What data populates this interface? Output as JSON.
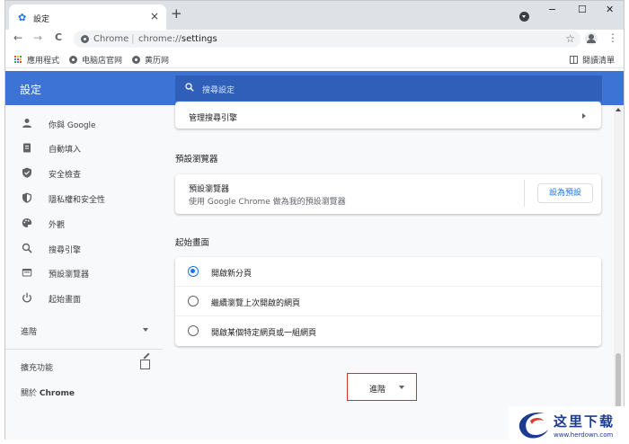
{
  "browser": {
    "tab_title": "設定",
    "tab_close": "×",
    "new_tab": "+",
    "window_controls": {
      "minimize": "−",
      "maximize": "☐",
      "close": "✕"
    },
    "nav": {
      "back": "←",
      "forward": "→",
      "reload": "C"
    },
    "chip": "Chrome",
    "url_sep": "|",
    "url_scheme": "chrome://",
    "url_path": "settings",
    "star": "☆",
    "menu": "⋮"
  },
  "bookmarks": {
    "items": [
      {
        "label": "應用程式",
        "icon": "apps-grid-icon"
      },
      {
        "label": "电脑店官网",
        "icon": "globe-icon"
      },
      {
        "label": "黄历网",
        "icon": "globe-icon"
      }
    ],
    "reading_list": "閱讀清單"
  },
  "header": {
    "title": "設定",
    "search_placeholder": "搜尋設定"
  },
  "sidebar": {
    "items": [
      {
        "label": "你與 Google",
        "icon": "person-icon"
      },
      {
        "label": "自動填入",
        "icon": "clipboard-icon"
      },
      {
        "label": "安全檢查",
        "icon": "shield-check-icon"
      },
      {
        "label": "隱私權和安全性",
        "icon": "shield-icon"
      },
      {
        "label": "外觀",
        "icon": "palette-icon"
      },
      {
        "label": "搜尋引擎",
        "icon": "search-icon"
      },
      {
        "label": "預設瀏覽器",
        "icon": "browser-icon"
      },
      {
        "label": "起始畫面",
        "icon": "power-icon"
      }
    ],
    "advanced": "進階",
    "extensions": "擴充功能",
    "about_prefix": "關於 ",
    "about_bold": "Chrome"
  },
  "main": {
    "manage_search_engines": "管理搜尋引擎",
    "default_browser_section": "預設瀏覽器",
    "default_browser_title": "預設瀏覽器",
    "default_browser_desc": "使用 Google Chrome 做為我的預設瀏覽器",
    "make_default_button": "設為預設",
    "startup_section": "起始畫面",
    "startup_options": [
      {
        "label": "開啟新分頁",
        "selected": true
      },
      {
        "label": "繼續瀏覽上次開啟的網頁",
        "selected": false
      },
      {
        "label": "開啟某個特定網頁或一組網頁",
        "selected": false
      }
    ],
    "advanced_button": "進階"
  },
  "watermark": {
    "text": "这里下载",
    "url": "www.herdown.com"
  },
  "colors": {
    "header_blue": "#3c73d4",
    "accent": "#1a73e8",
    "highlight_border": "#d93025"
  }
}
